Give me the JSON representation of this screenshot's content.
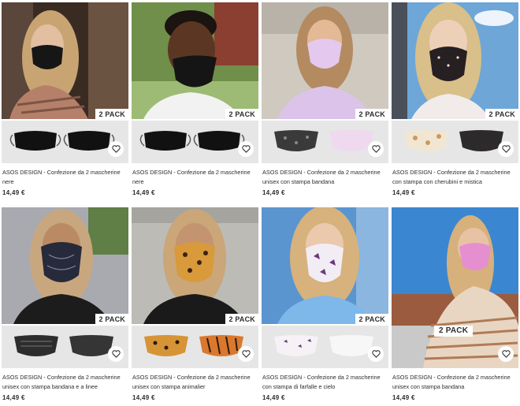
{
  "products": [
    {
      "title": "ASOS DESIGN - Confezione da 2 mascherine nere",
      "price": "14,49 €",
      "badge": "2 PACK"
    },
    {
      "title": "ASOS DESIGN - Confezione da 2 mascherine nere",
      "price": "14,49 €",
      "badge": "2 PACK"
    },
    {
      "title": "ASOS DESIGN - Confezione da 2 mascherine unisex con stampa bandana",
      "price": "14,49 €",
      "badge": "2 PACK"
    },
    {
      "title": "ASOS DESIGN - Confezione da 2 mascherine con stampa con cherubini e mistica",
      "price": "14,49 €",
      "badge": "2 PACK"
    },
    {
      "title": "ASOS DESIGN - Confezione da 2 mascherine unisex con stampa bandana e a linee",
      "price": "14,49 €",
      "badge": "2 PACK"
    },
    {
      "title": "ASOS DESIGN - Confezione da 2 mascherine unisex con stampa animalier",
      "price": "14,49 €",
      "badge": "2 PACK"
    },
    {
      "title": "ASOS DESIGN - Confezione da 2 mascherine con stampa di farfalle e cielo",
      "price": "14,49 €",
      "badge": "2 PACK"
    },
    {
      "title": "ASOS DESIGN - Confezione da 2 mascherine unisex con stampa bandana",
      "price": "14,49 €",
      "badge": "2 PACK"
    }
  ],
  "icons": {
    "wishlist": "heart-icon"
  },
  "colors": {
    "text": "#2d2d2d",
    "strip_bg": "#e6e6e6",
    "badge_bg": "#ffffff"
  }
}
